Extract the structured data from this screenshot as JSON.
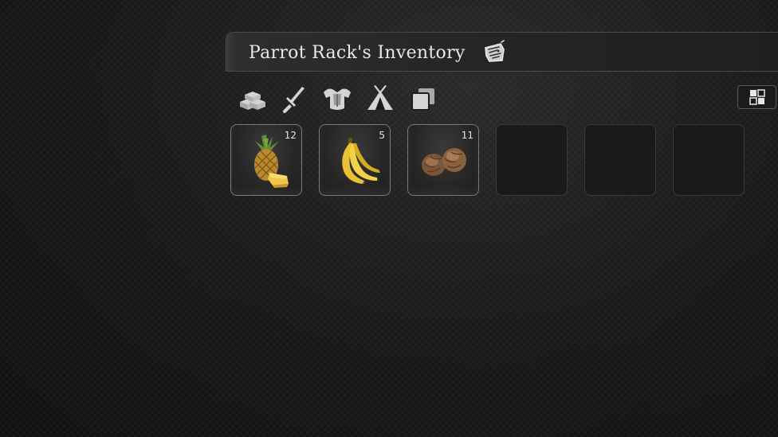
{
  "inventory": {
    "title": "Parrot Rack's Inventory",
    "title_icon": "parrot-sketch-icon"
  },
  "tabs": [
    {
      "name": "tab-resources",
      "icon": "stacked-ingots-icon"
    },
    {
      "name": "tab-weapons",
      "icon": "sword-icon"
    },
    {
      "name": "tab-armor",
      "icon": "armor-chest-icon"
    },
    {
      "name": "tab-building",
      "icon": "tent-icon"
    },
    {
      "name": "tab-misc",
      "icon": "stacked-squares-icon"
    }
  ],
  "layout_toggle_icon": "grid-layout-icon",
  "slots": [
    {
      "item": "pineapple",
      "icon": "pineapple-icon",
      "quantity": "12"
    },
    {
      "item": "banana",
      "icon": "banana-icon",
      "quantity": "5"
    },
    {
      "item": "nuts",
      "icon": "walnut-icon",
      "quantity": "11"
    },
    {
      "item": null,
      "quantity": ""
    },
    {
      "item": null,
      "quantity": ""
    },
    {
      "item": null,
      "quantity": ""
    }
  ],
  "colors": {
    "text": "#ece8e0",
    "icon": "#d4d4d4",
    "slot_border_filled": "#7a7a7a",
    "slot_border_empty": "#3a3a3a"
  }
}
